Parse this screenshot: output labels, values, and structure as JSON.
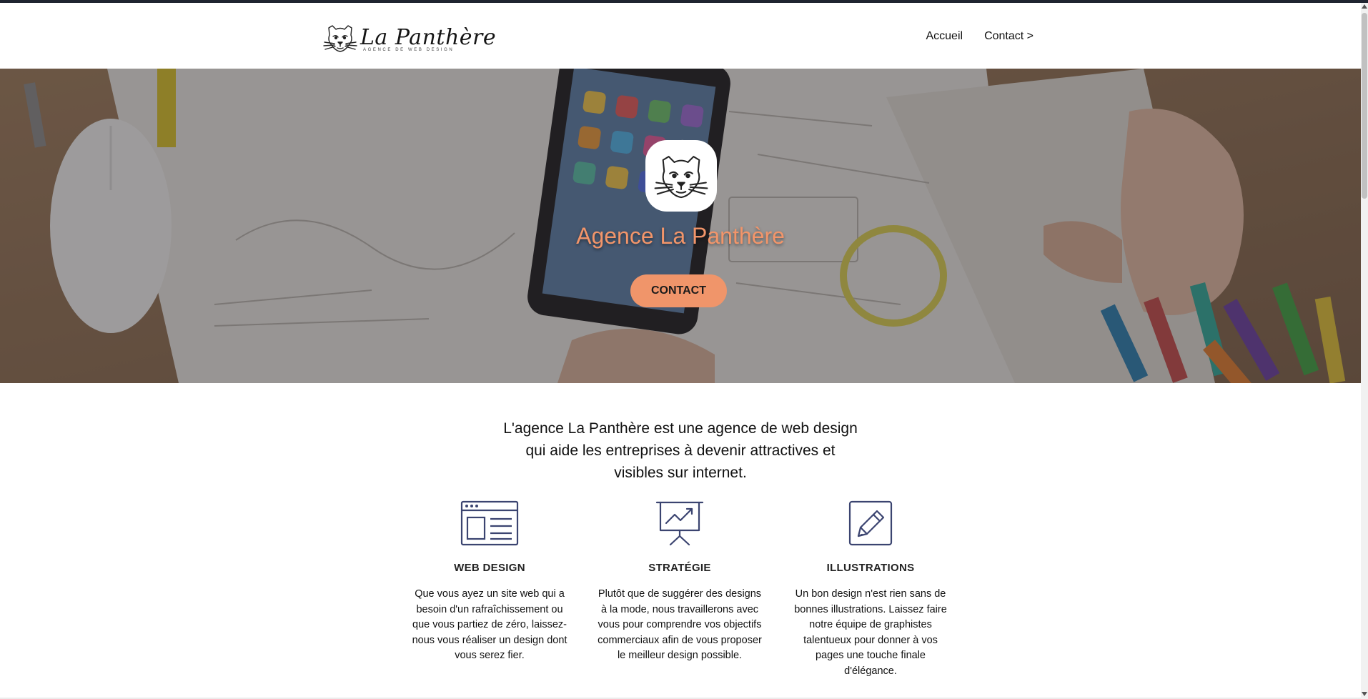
{
  "header": {
    "logo_title": "La Panthère",
    "logo_tagline": "AGENCE DE WEB DESIGN",
    "logo_icon": "panther-head-icon",
    "nav": [
      {
        "label": "Accueil"
      },
      {
        "label": "Contact >"
      }
    ]
  },
  "hero": {
    "badge_icon": "panther-head-icon",
    "title": "Agence La Panthère",
    "button_label": "CONTACT",
    "title_color": "#f2956a",
    "button_color": "#f0956a"
  },
  "intro": {
    "text": "L'agence La Panthère est une agence de web design qui aide les entreprises à devenir attractives et visibles sur internet."
  },
  "services": [
    {
      "icon": "web-design-icon",
      "title": "WEB DESIGN",
      "text": "Que vous ayez un site web qui a besoin d'un rafraîchissement ou que vous partiez de zéro, laissez-nous vous réaliser un design dont vous serez fier."
    },
    {
      "icon": "strategy-chart-icon",
      "title": "STRATÉGIE",
      "text": "Plutôt que de suggérer des designs à la mode, nous travaillerons avec vous pour comprendre vos objectifs commerciaux afin de vous proposer le meilleur design possible."
    },
    {
      "icon": "pencil-icon",
      "title": "ILLUSTRATIONS",
      "text": "Un bon design n'est rien sans de bonnes illustrations. Laissez faire notre équipe de graphistes talentueux pour donner à vos pages une touche finale d'élégance."
    }
  ],
  "colors": {
    "accent": "#f0956a",
    "icon_stroke": "#3b4470"
  }
}
